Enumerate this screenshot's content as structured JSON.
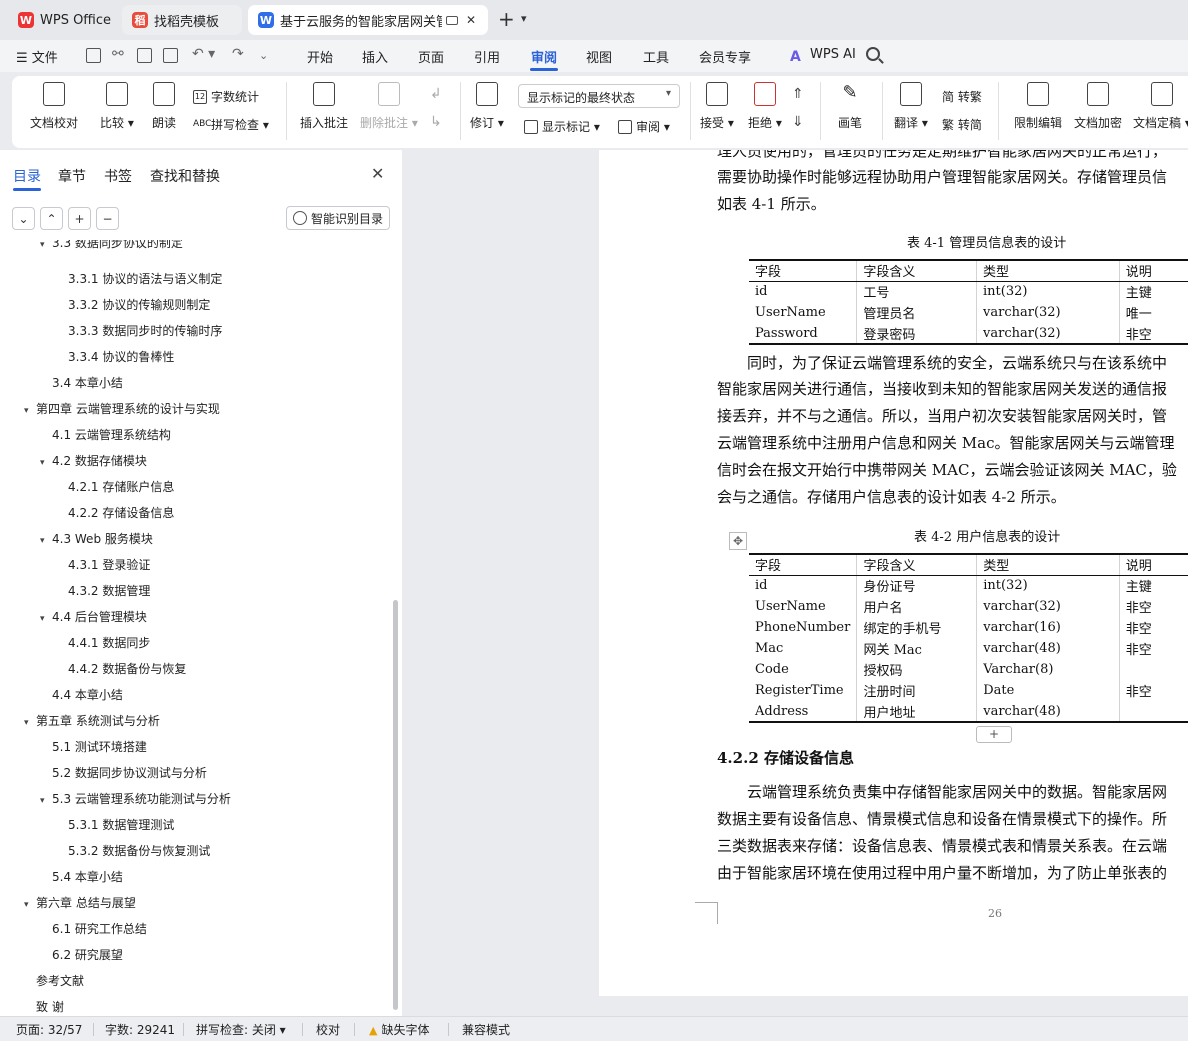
{
  "tabs": [
    {
      "label": "WPS Office",
      "logo": "W"
    },
    {
      "label": "找稻壳模板",
      "logo": "稻"
    },
    {
      "label": "基于云服务的智能家居网关管理",
      "logo": "W"
    }
  ],
  "menubar": {
    "file": "文件",
    "menus": [
      "开始",
      "插入",
      "页面",
      "引用",
      "审阅",
      "视图",
      "工具",
      "会员专享"
    ],
    "active": "审阅",
    "ai": "WPS AI"
  },
  "ribbon": {
    "proofread": "文档校对",
    "compare": "比较",
    "read_aloud": "朗读",
    "word_count": "字数统计",
    "spell_check": "拼写检查",
    "insert_comment": "插入批注",
    "delete_comment": "删除批注",
    "revise": "修订",
    "markup_state": "显示标记的最终状态",
    "show_markup": "显示标记",
    "review_pane": "审阅",
    "accept": "接受",
    "reject": "拒绝",
    "pen": "画笔",
    "translate": "翻译",
    "to_traditional": "简 转繁",
    "to_simplified": "繁 转简",
    "restrict_editing": "限制编辑",
    "encrypt": "文档加密",
    "finalize": "文档定稿"
  },
  "nav": {
    "tabs": [
      "目录",
      "章节",
      "书签",
      "查找和替换"
    ],
    "smart_toc": "智能识别目录",
    "items": [
      {
        "text": "3.3  数据同步协议的制定",
        "level": 2,
        "arrow": "▾"
      },
      {
        "text": "3.3.1  协议的语法与语义制定",
        "level": 3,
        "arrow": ""
      },
      {
        "text": "3.3.2  协议的传输规则制定",
        "level": 3,
        "arrow": ""
      },
      {
        "text": "3.3.3  数据同步时的传输时序",
        "level": 3,
        "arrow": ""
      },
      {
        "text": "3.3.4  协议的鲁棒性",
        "level": 3,
        "arrow": ""
      },
      {
        "text": "3.4  本章小结",
        "level": 2,
        "arrow": ""
      },
      {
        "text": "第四章  云端管理系统的设计与实现",
        "level": 1,
        "arrow": "▾"
      },
      {
        "text": "4.1  云端管理系统结构",
        "level": 2,
        "arrow": ""
      },
      {
        "text": "4.2  数据存储模块",
        "level": 2,
        "arrow": "▾"
      },
      {
        "text": "4.2.1  存储账户信息",
        "level": 3,
        "arrow": ""
      },
      {
        "text": "4.2.2  存储设备信息",
        "level": 3,
        "arrow": ""
      },
      {
        "text": "4.3 Web 服务模块",
        "level": 2,
        "arrow": "▾"
      },
      {
        "text": "4.3.1  登录验证",
        "level": 3,
        "arrow": ""
      },
      {
        "text": "4.3.2  数据管理",
        "level": 3,
        "arrow": ""
      },
      {
        "text": "4.4  后台管理模块",
        "level": 2,
        "arrow": "▾"
      },
      {
        "text": "4.4.1  数据同步",
        "level": 3,
        "arrow": ""
      },
      {
        "text": "4.4.2  数据备份与恢复",
        "level": 3,
        "arrow": ""
      },
      {
        "text": "4.4  本章小结",
        "level": 2,
        "arrow": ""
      },
      {
        "text": "第五章  系统测试与分析",
        "level": 1,
        "arrow": "▾"
      },
      {
        "text": "5.1  测试环境搭建",
        "level": 2,
        "arrow": ""
      },
      {
        "text": "5.2  数据同步协议测试与分析",
        "level": 2,
        "arrow": ""
      },
      {
        "text": "5.3  云端管理系统功能测试与分析",
        "level": 2,
        "arrow": "▾"
      },
      {
        "text": "5.3.1  数据管理测试",
        "level": 3,
        "arrow": ""
      },
      {
        "text": "5.3.2  数据备份与恢复测试",
        "level": 3,
        "arrow": ""
      },
      {
        "text": "5.4  本章小结",
        "level": 2,
        "arrow": ""
      },
      {
        "text": "第六章    总结与展望",
        "level": 1,
        "arrow": "▾"
      },
      {
        "text": "6.1  研究工作总结",
        "level": 2,
        "arrow": ""
      },
      {
        "text": "6.2  研究展望",
        "level": 2,
        "arrow": ""
      },
      {
        "text": "参考文献",
        "level": 1,
        "arrow": ""
      },
      {
        "text": "致    谢",
        "level": 1,
        "arrow": ""
      }
    ]
  },
  "document": {
    "paragraphs_top": [
      "理人员使用的，管理员的任务是定期维护智能家居网关的正常运行，",
      "需要协助操作时能够远程协助用户管理智能家居网关。存储管理员信",
      "如表 4-1 所示。"
    ],
    "table1": {
      "caption": "表 4-1    管理员信息表的设计",
      "header": [
        "字段",
        "字段含义",
        "类型",
        "说明"
      ],
      "rows": [
        [
          "id",
          "工号",
          "int(32)",
          "主键"
        ],
        [
          "UserName",
          "管理员名",
          "varchar(32)",
          "唯一"
        ],
        [
          "Password",
          "登录密码",
          "varchar(32)",
          "非空"
        ]
      ]
    },
    "paragraphs_mid": [
      "同时，为了保证云端管理系统的安全，云端系统只与在该系统中",
      "智能家居网关进行通信，当接收到未知的智能家居网关发送的通信报",
      "接丢弃，并不与之通信。所以，当用户初次安装智能家居网关时，管",
      "云端管理系统中注册用户信息和网关 Mac。智能家居网关与云端管理",
      "信时会在报文开始行中携带网关 MAC，云端会验证该网关 MAC，验",
      "会与之通信。存储用户信息表的设计如表 4-2 所示。"
    ],
    "table2": {
      "caption": "表 4-2    用户信息表的设计",
      "header": [
        "字段",
        "字段含义",
        "类型",
        "说明"
      ],
      "rows": [
        [
          "id",
          "身份证号",
          "int(32)",
          "主键"
        ],
        [
          "UserName",
          "用户名",
          "varchar(32)",
          "非空"
        ],
        [
          "PhoneNumber",
          "绑定的手机号",
          "varchar(16)",
          "非空"
        ],
        [
          "Mac",
          "网关 Mac",
          "varchar(48)",
          "非空"
        ],
        [
          "Code",
          "授权码",
          "Varchar(8)",
          ""
        ],
        [
          "RegisterTime",
          "注册时间",
          "Date",
          "非空"
        ],
        [
          "Address",
          "用户地址",
          "varchar(48)",
          ""
        ]
      ]
    },
    "heading": "4.2.2  存储设备信息",
    "paragraphs_bottom": [
      "云端管理系统负责集中存储智能家居网关中的数据。智能家居网",
      "数据主要有设备信息、情景模式信息和设备在情景模式下的操作。所",
      "三类数据表来存储：设备信息表、情景模式表和情景关系表。在云端",
      "由于智能家居环境在使用过程中用户量不断增加，为了防止单张表的"
    ],
    "page_number": "26"
  },
  "statusbar": {
    "page": "页面: 32/57",
    "words": "字数: 29241",
    "spell": "拼写检查: 关闭",
    "proof": "校对",
    "missing_font": "缺失字体",
    "compat": "兼容模式"
  }
}
